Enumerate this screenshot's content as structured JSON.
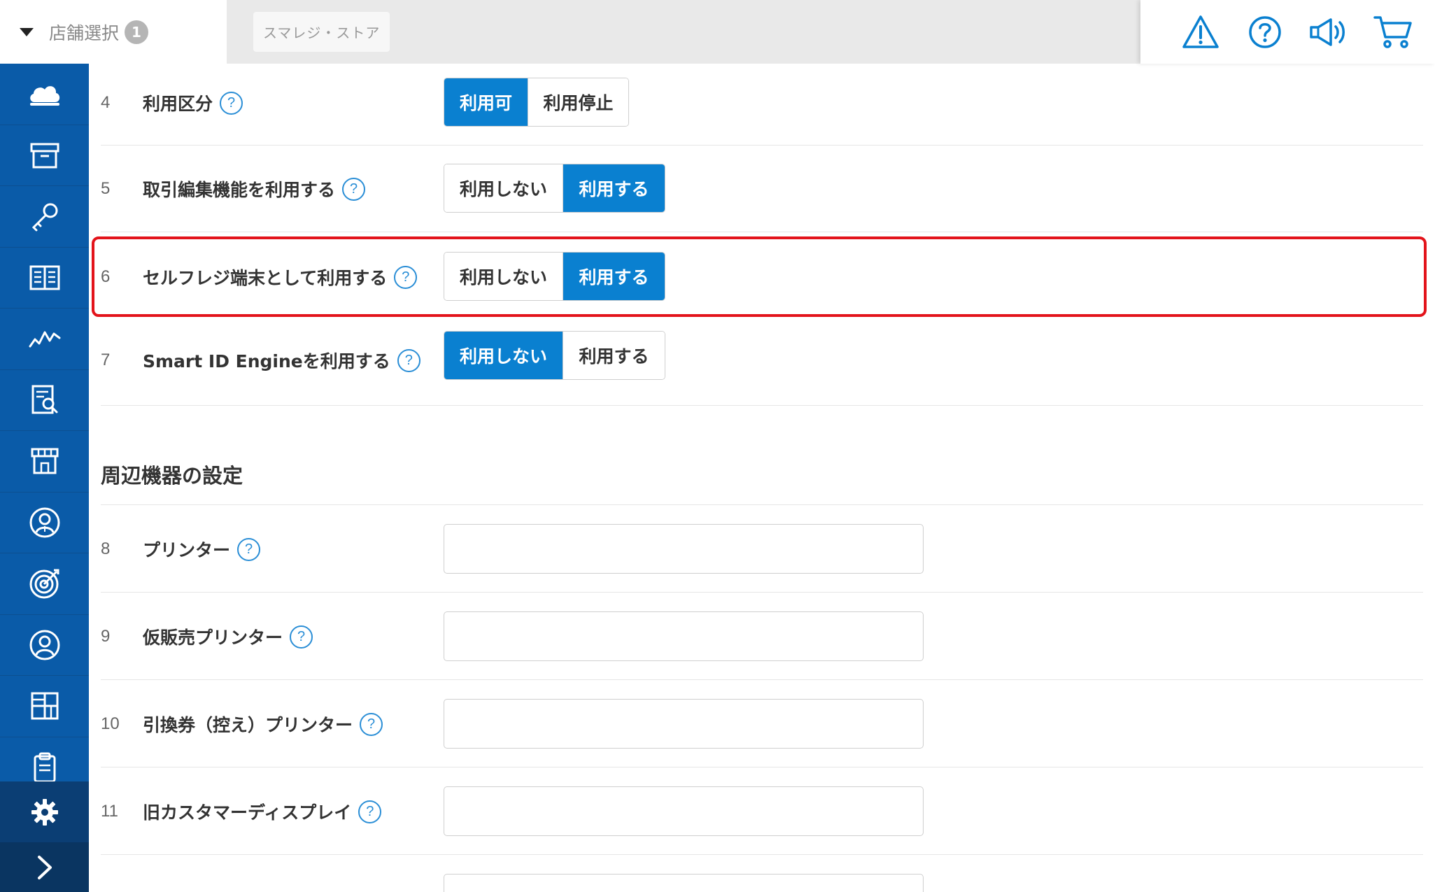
{
  "header": {
    "store_select_label": "店舗選択",
    "store_count": "1",
    "store_name": "スマレジ・ストア",
    "icons": [
      "warning-icon",
      "help-circle-icon",
      "megaphone-icon",
      "cart-icon"
    ]
  },
  "sidebar": {
    "items": [
      {
        "icon": "cloud-icon"
      },
      {
        "icon": "archive-box-icon"
      },
      {
        "icon": "key-icon"
      },
      {
        "icon": "book-icon"
      },
      {
        "icon": "chart-line-icon"
      },
      {
        "icon": "report-search-icon"
      },
      {
        "icon": "store-icon"
      },
      {
        "icon": "staff-icon"
      },
      {
        "icon": "target-icon"
      },
      {
        "icon": "customer-icon"
      },
      {
        "icon": "grid-icon"
      },
      {
        "icon": "clipboard-icon"
      }
    ],
    "settings_icon": "gear-icon",
    "expand_icon": "chevron-right-icon"
  },
  "settings_rows": [
    {
      "num": "4",
      "label": "利用区分",
      "options": [
        "利用可",
        "利用停止"
      ],
      "selected": 0
    },
    {
      "num": "5",
      "label": "取引編集機能を利用する",
      "options": [
        "利用しない",
        "利用する"
      ],
      "selected": 1
    },
    {
      "num": "6",
      "label": "セルフレジ端末として利用する",
      "options": [
        "利用しない",
        "利用する"
      ],
      "selected": 1
    },
    {
      "num": "7",
      "label": "Smart ID Engineを利用する",
      "options": [
        "利用しない",
        "利用する"
      ],
      "selected": 0
    }
  ],
  "section_title": "周辺機器の設定",
  "device_rows": [
    {
      "num": "8",
      "label": "プリンター",
      "value": ""
    },
    {
      "num": "9",
      "label": "仮販売プリンター",
      "value": ""
    },
    {
      "num": "10",
      "label": "引換券（控え）プリンター",
      "value": ""
    },
    {
      "num": "11",
      "label": "旧カスタマーディスプレイ",
      "value": ""
    }
  ],
  "help_glyph": "?",
  "colors": {
    "sidebar": "#0a5ba8",
    "accent": "#0a80d0",
    "highlight": "#e3141b"
  }
}
